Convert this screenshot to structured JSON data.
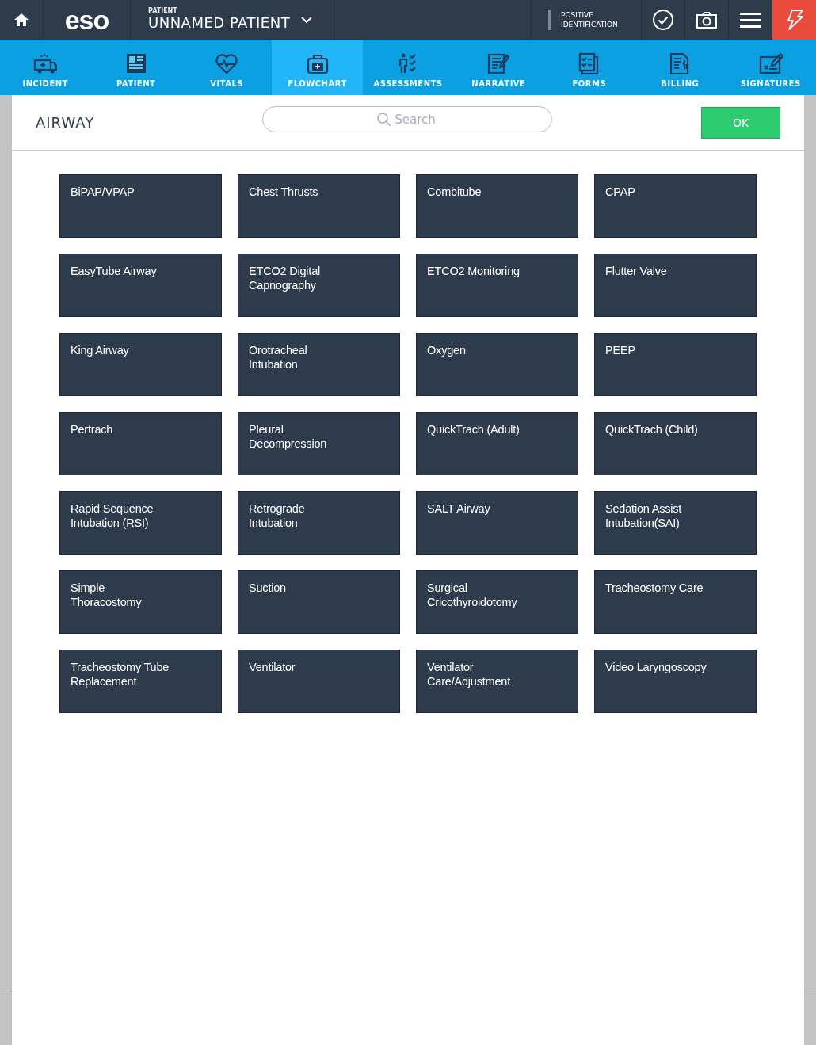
{
  "top_bar": {
    "logo": "eso",
    "patient_label": "PATIENT",
    "patient_name": "UNNAMED PATIENT",
    "positive_identification": "POSITIVE IDENTIFICATION"
  },
  "tabs": [
    {
      "label": "INCIDENT",
      "selected": false
    },
    {
      "label": "PATIENT",
      "selected": false
    },
    {
      "label": "VITALS",
      "selected": false
    },
    {
      "label": "FLOWCHART",
      "selected": true
    },
    {
      "label": "ASSESSMENTS",
      "selected": false
    },
    {
      "label": "NARRATIVE",
      "selected": false
    },
    {
      "label": "FORMS",
      "selected": false
    },
    {
      "label": "BILLING",
      "selected": false
    },
    {
      "label": "SIGNATURES",
      "selected": false
    }
  ],
  "panel": {
    "title": "AIRWAY",
    "search": {
      "placeholder": "Search"
    },
    "ok_button": "OK",
    "procedures": [
      "BiPAP/VPAP",
      "Chest Thrusts",
      "Combitube",
      "CPAP",
      "EasyTube Airway",
      "ETCO2 Digital Capnography",
      "ETCO2 Monitoring",
      "Flutter Valve",
      "King Airway",
      "Orotracheal Intubation",
      "Oxygen",
      "PEEP",
      "Pertrach",
      "Pleural Decompression",
      "QuickTrach (Adult)",
      "QuickTrach (Child)",
      "Rapid Sequence Intubation (RSI)",
      "Retrograde Intubation",
      "SALT Airway",
      "Sedation Assist Intubation(SAI)",
      "Simple Thoracostomy",
      "Suction",
      "Surgical Cricothyroidotomy",
      "Tracheostomy Care",
      "Tracheostomy Tube Replacement",
      "Ventilator",
      "Ventilator Care/Adjustment",
      "Video Laryngoscopy"
    ]
  }
}
